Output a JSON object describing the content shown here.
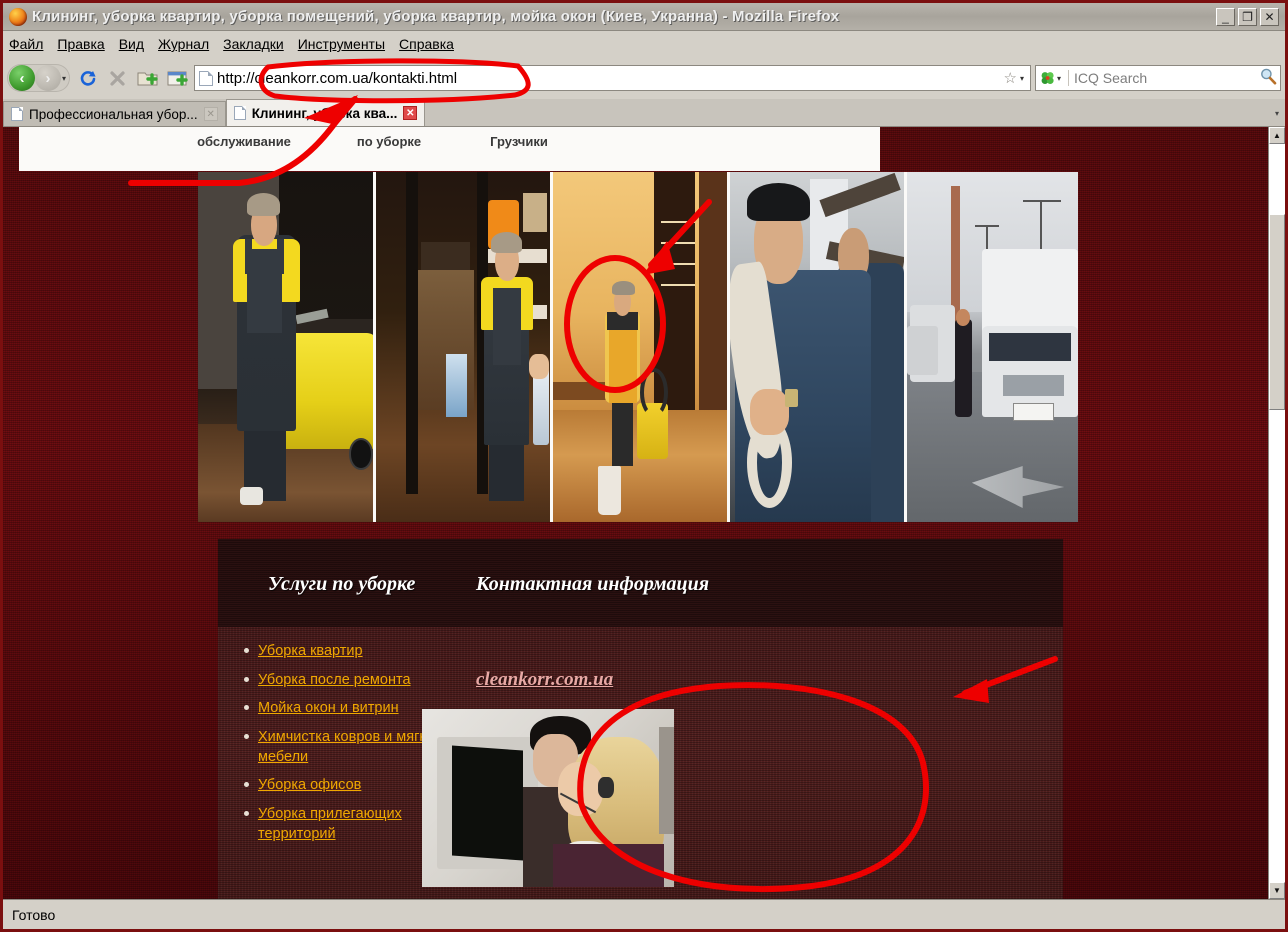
{
  "window": {
    "title": "Клининг, уборка квартир, уборка помещений, уборка квартир, мойка окон (Киев, Укранна) - Mozilla Firefox",
    "minimize": "_",
    "restore": "❐",
    "close": "✕"
  },
  "menu": {
    "items": [
      {
        "label": "Файл"
      },
      {
        "label": "Правка"
      },
      {
        "label": "Вид"
      },
      {
        "label": "Журнал"
      },
      {
        "label": "Закладки"
      },
      {
        "label": "Инструменты"
      },
      {
        "label": "Справка"
      }
    ]
  },
  "toolbar": {
    "back_icon": "‹",
    "forward_icon": "›",
    "history_caret": "▾",
    "reload_icon": "⟳",
    "stop_icon": "✕",
    "newfolder_icon": "folder-plus-icon",
    "newwindow_icon": "window-plus-icon",
    "star_icon": "☆",
    "star_caret": "▾",
    "search_caret": "▾",
    "magnifier_icon": "🔍"
  },
  "url": {
    "value": "http://cleankorr.com.ua/kontakti.html"
  },
  "search": {
    "placeholder": "ICQ Search",
    "engine": "ICQ"
  },
  "tabs": {
    "list_caret": "▾",
    "items": [
      {
        "label": "Профессиональная убор...",
        "active": false,
        "close": "✕"
      },
      {
        "label": "Клининг, уборка ква...",
        "active": true,
        "close": "✕"
      }
    ]
  },
  "page": {
    "site_nav": [
      {
        "label": "обслуживание"
      },
      {
        "label": "по уборке"
      },
      {
        "label": "Грузчики"
      }
    ],
    "photos": [
      {
        "alt": "Уборщик с желтой тележкой"
      },
      {
        "alt": "Уборщица в дверях магазина"
      },
      {
        "alt": "Уборщица с пылесосом в коридоре"
      },
      {
        "alt": "Грузчик с веревкой"
      },
      {
        "alt": "Грузовые автомобили Газель"
      }
    ],
    "headings": {
      "services": "Услуги по уборке",
      "contacts": "Контактная информация"
    },
    "services_links": [
      {
        "label": "Уборка квартир"
      },
      {
        "label": "Уборка после ремонта"
      },
      {
        "label": "Мойка окон и витрин"
      },
      {
        "label": "Химчистка ковров и мягкой мебели"
      },
      {
        "label": "Уборка офисов"
      },
      {
        "label": "Уборка прилегающих территорий"
      }
    ],
    "watermark": "cleankorr.com.ua",
    "contact_photo_alt": "Операторы колл-центра в гарнитурах"
  },
  "scrollbar": {
    "up_arrow": "▲",
    "down_arrow": "▼"
  },
  "status": {
    "text": "Готово"
  },
  "annotations": {
    "color": "#ee0000",
    "marks": [
      {
        "name": "url-ellipse",
        "type": "ellipse"
      },
      {
        "name": "url-arrow",
        "type": "arrow"
      },
      {
        "name": "worker-ellipse",
        "type": "ellipse"
      },
      {
        "name": "worker-arrow",
        "type": "arrow"
      },
      {
        "name": "callcenter-ellipse",
        "type": "ellipse"
      },
      {
        "name": "callcenter-arrow",
        "type": "arrow"
      }
    ]
  },
  "colors": {
    "chrome": "#d4d0c8",
    "page_bg": "#6e0c10",
    "panel_bg": "#4a1b1b",
    "link": "#f0a800",
    "watermark": "#e8a9a5",
    "annotation": "#ee0000"
  }
}
